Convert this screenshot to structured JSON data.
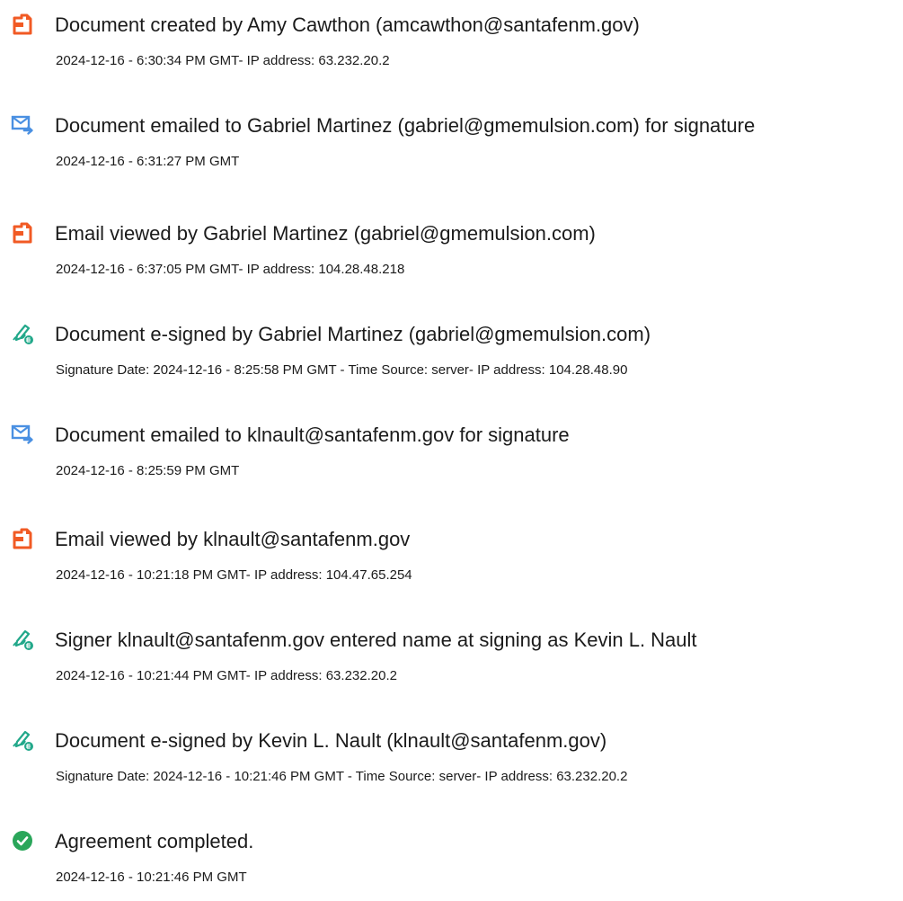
{
  "colors": {
    "document_icon": "#f15a24",
    "email_icon": "#4a90e2",
    "esign_icon": "#22a88a",
    "complete_icon": "#2aa65a",
    "text": "#1b1b1b"
  },
  "events": [
    {
      "icon": "document-icon",
      "title": "Document created by Amy Cawthon (amcawthon@santafenm.gov)",
      "detail": "2024-12-16 - 6:30:34 PM GMT- IP address: 63.232.20.2"
    },
    {
      "icon": "email-sent-icon",
      "title": "Document emailed to Gabriel Martinez (gabriel@gmemulsion.com) for signature",
      "detail": "2024-12-16 - 6:31:27 PM GMT"
    },
    {
      "icon": "document-icon",
      "title": "Email viewed by Gabriel Martinez (gabriel@gmemulsion.com)",
      "detail": "2024-12-16 - 6:37:05 PM GMT- IP address: 104.28.48.218"
    },
    {
      "icon": "esign-pen-icon",
      "title": "Document e-signed by Gabriel Martinez (gabriel@gmemulsion.com)",
      "detail": "Signature Date: 2024-12-16 - 8:25:58 PM GMT - Time Source: server- IP address: 104.28.48.90"
    },
    {
      "icon": "email-sent-icon",
      "title": "Document emailed to klnault@santafenm.gov for signature",
      "detail": "2024-12-16 - 8:25:59 PM GMT"
    },
    {
      "icon": "document-icon",
      "title": "Email viewed by klnault@santafenm.gov",
      "detail": "2024-12-16 - 10:21:18 PM GMT- IP address: 104.47.65.254"
    },
    {
      "icon": "esign-pen-icon",
      "title": "Signer klnault@santafenm.gov entered name at signing as Kevin L. Nault",
      "detail": "2024-12-16 - 10:21:44 PM GMT- IP address: 63.232.20.2"
    },
    {
      "icon": "esign-pen-icon",
      "title": "Document e-signed by Kevin L. Nault (klnault@santafenm.gov)",
      "detail": "Signature Date: 2024-12-16 - 10:21:46 PM GMT - Time Source: server- IP address: 63.232.20.2"
    },
    {
      "icon": "checkmark-circle-icon",
      "title": "Agreement completed.",
      "detail": "2024-12-16 - 10:21:46 PM GMT"
    }
  ]
}
